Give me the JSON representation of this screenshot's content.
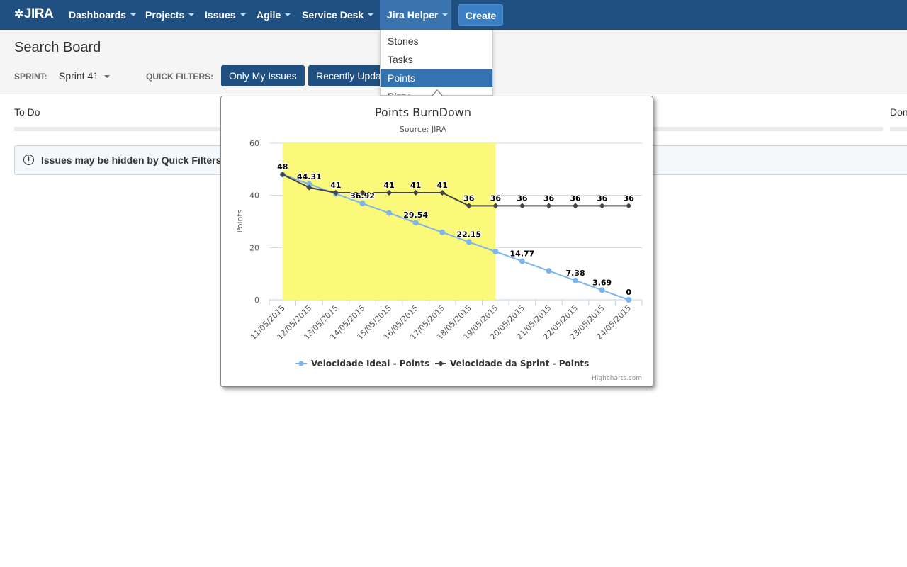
{
  "nav": {
    "logo": "JIRA",
    "items": [
      "Dashboards",
      "Projects",
      "Issues",
      "Agile",
      "Service Desk",
      "Jira Helper"
    ],
    "create_label": "Create"
  },
  "header": {
    "title": "Search Board",
    "sprint_label": "SPRINT:",
    "sprint_value": "Sprint 41",
    "quick_filters_label": "QUICK FILTERS:",
    "quick_filters": [
      "Only My Issues",
      "Recently Updated"
    ]
  },
  "columns": [
    "To Do",
    "Done"
  ],
  "notice": "Issues may be hidden by Quick Filters",
  "dropdown": {
    "items": [
      "Stories",
      "Tasks",
      "Points",
      "Bizzo"
    ],
    "selected": "Points"
  },
  "chart_data": {
    "type": "line",
    "title": "Points BurnDown",
    "subtitle": "Source: JIRA",
    "ylabel": "Points",
    "ylim": [
      0,
      60
    ],
    "yticks": [
      0,
      20,
      40,
      60
    ],
    "categories": [
      "11/05/2015",
      "12/05/2015",
      "13/05/2015",
      "14/05/2015",
      "15/05/2015",
      "16/05/2015",
      "17/05/2015",
      "18/05/2015",
      "19/05/2015",
      "20/05/2015",
      "21/05/2015",
      "22/05/2015",
      "23/05/2015",
      "24/05/2015"
    ],
    "highlight_band": {
      "from": "11/05/2015",
      "to": "18/05/2015",
      "color": "#fbf97a"
    },
    "series": [
      {
        "name": "Velocidade Ideal - Points",
        "color": "#7cb5ec",
        "marker": "circle",
        "values": [
          48,
          44.31,
          40.62,
          36.92,
          33.23,
          29.54,
          25.85,
          22.15,
          18.46,
          14.77,
          11.08,
          7.38,
          3.69,
          0
        ],
        "labels": [
          null,
          "44.31",
          null,
          "36.92",
          null,
          "29.54",
          null,
          "22.15",
          null,
          "14.77",
          null,
          "7.38",
          "3.69",
          "0"
        ]
      },
      {
        "name": "Velocidade da Sprint - Points",
        "color": "#434348",
        "marker": "diamond",
        "values": [
          48,
          43,
          41,
          41,
          41,
          41,
          41,
          36,
          36,
          36,
          36,
          36,
          36,
          36
        ],
        "labels": [
          "48",
          null,
          "41",
          null,
          "41",
          "41",
          "41",
          "36",
          "36",
          "36",
          "36",
          "36",
          "36",
          "36"
        ]
      }
    ],
    "credits": "Highcharts.com",
    "legend": "bottom-center"
  }
}
